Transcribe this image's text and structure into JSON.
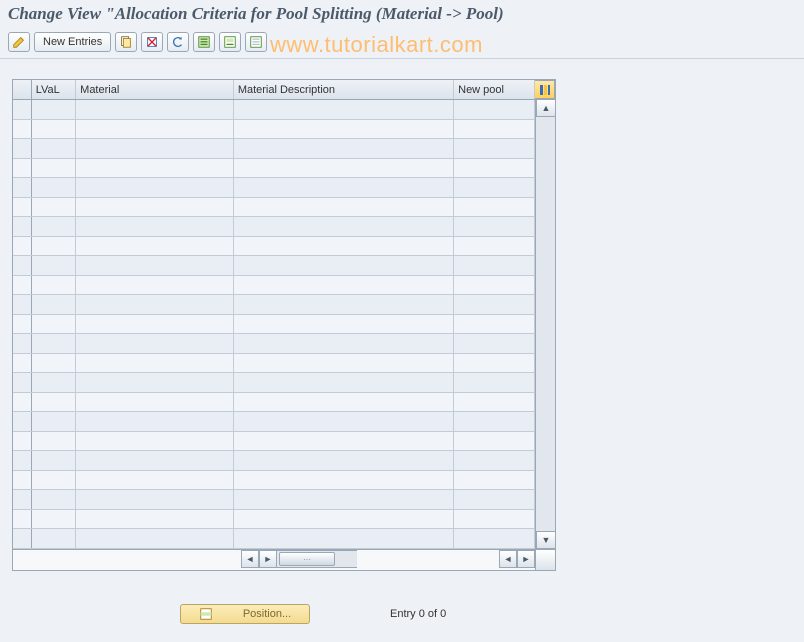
{
  "title": "Change View \"Allocation Criteria for Pool Splitting (Material -> Pool)",
  "watermark": "www.tutorialkart.com",
  "toolbar": {
    "new_entries_label": "New Entries"
  },
  "table": {
    "columns": {
      "lval": "LVaL",
      "material": "Material",
      "material_desc": "Material Description",
      "new_pool": "New pool"
    },
    "row_count": 23
  },
  "footer": {
    "position_label": "Position...",
    "entry_text": "Entry 0 of 0"
  }
}
